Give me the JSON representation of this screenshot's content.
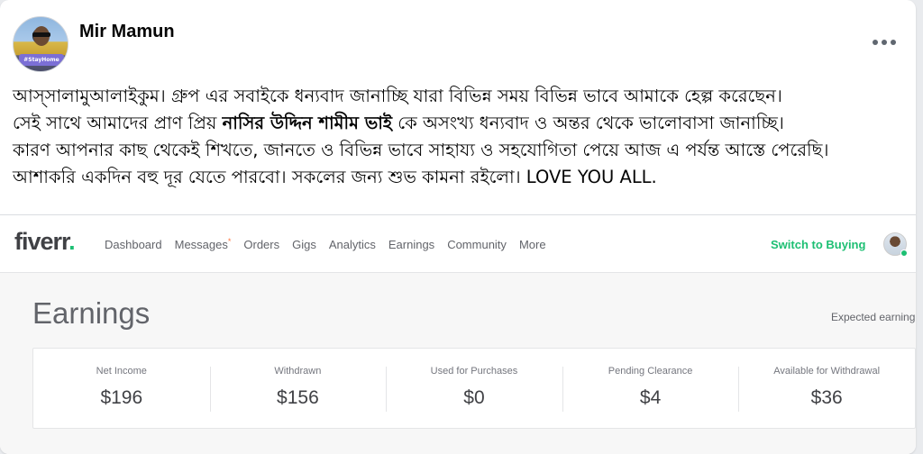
{
  "post": {
    "author": "Mir Mamun",
    "avatar_badge": "#StayHome",
    "text": {
      "line1": "আস্সালামুআলাইকুম। গ্রুপ এর সবাইকে ধন্যবাদ জানাচ্ছি যারা বিভিন্ন সময় বিভিন্ন ভাবে আমাকে হেল্প করেছেন।",
      "line2_pre": "সেই সাথে আমাদের প্রাণ প্রিয় ",
      "line2_bold": "নাসির উদ্দিন শামীম ভাই",
      "line2_post": " কে অসংখ্য ধন্যবাদ ও অন্তর থেকে ভালোবাসা জানাচ্ছি।",
      "line3": "কারণ আপনার কাছ থেকেই শিখতে, জানতে ও বিভিন্ন ভাবে সাহায্য ও সহযোগিতা পেয়ে আজ এ পর্যন্ত আস্তে পেরেছি।",
      "line4": "আশাকরি একদিন বহু দূর যেতে পারবো। সকলের জন্য শুভ কামনা রইলো। LOVE YOU ALL."
    }
  },
  "fiverr": {
    "logo_text": "fiverr",
    "logo_dot": ".",
    "nav": [
      {
        "label": "Dashboard"
      },
      {
        "label": "Messages",
        "badge": "*"
      },
      {
        "label": "Orders"
      },
      {
        "label": "Gigs"
      },
      {
        "label": "Analytics"
      },
      {
        "label": "Earnings"
      },
      {
        "label": "Community"
      },
      {
        "label": "More"
      }
    ],
    "switch_label": "Switch to Buying",
    "brand_color": "#1dbf73",
    "earnings_title": "Earnings",
    "expected_label": "Expected earning",
    "stats": [
      {
        "label": "Net Income",
        "value": "$196"
      },
      {
        "label": "Withdrawn",
        "value": "$156"
      },
      {
        "label": "Used for Purchases",
        "value": "$0"
      },
      {
        "label": "Pending Clearance",
        "value": "$4"
      },
      {
        "label": "Available for Withdrawal",
        "value": "$36"
      }
    ]
  }
}
